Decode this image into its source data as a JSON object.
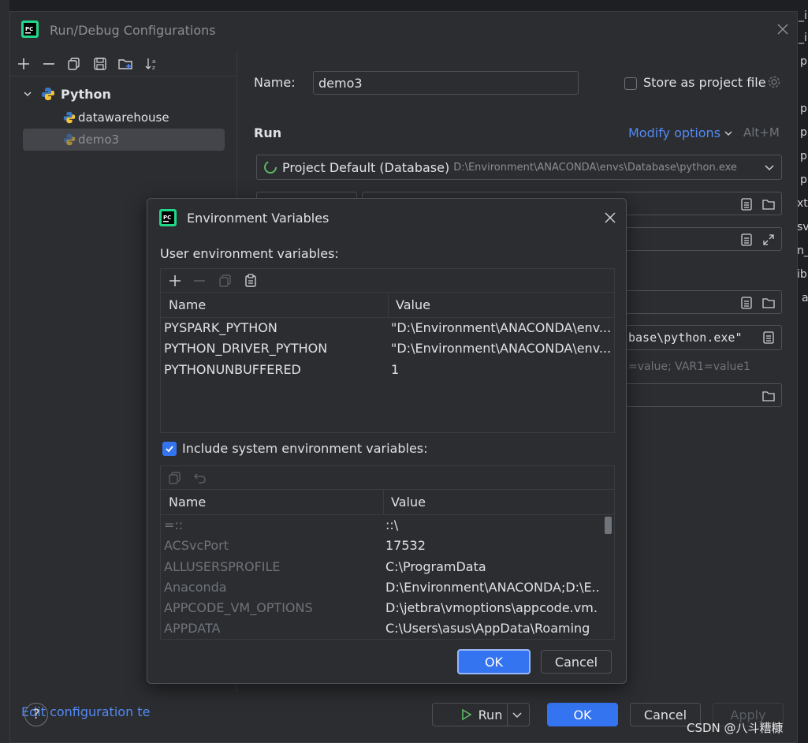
{
  "background": {
    "right_fragments": [
      "_i",
      "_i",
      "p",
      "p",
      "p",
      "p",
      "p",
      "xt",
      "sv",
      "n_",
      "ib",
      "a"
    ]
  },
  "main_dialog": {
    "title": "Run/Debug Configurations",
    "tree": {
      "group_label": "Python",
      "items": [
        "datawarehouse",
        "demo3"
      ]
    },
    "edit_config_link": "Edit configuration te",
    "name_label": "Name:",
    "name_value": "demo3",
    "store_as_project_file": "Store as project file",
    "run_section": "Run",
    "modify_options": "Modify options",
    "modify_shortcut": "Alt+M",
    "interpreter_name": "Project Default (Database)",
    "interpreter_path": "D:\\Environment\\ANACONDA\\envs\\Database\\python.exe",
    "interpreter_quote_fragment": "base\\python.exe\"",
    "env_hint_fragment": "=value; VAR1=value1",
    "buttons": {
      "run": "Run",
      "ok": "OK",
      "cancel": "Cancel",
      "apply": "Apply"
    }
  },
  "env_dialog": {
    "title": "Environment Variables",
    "user_vars_label": "User environment variables:",
    "columns": {
      "name": "Name",
      "value": "Value"
    },
    "user_vars": [
      {
        "name": "PYSPARK_PYTHON",
        "value": "\"D:\\Environment\\ANACONDA\\env..."
      },
      {
        "name": "PYTHON_DRIVER_PYTHON",
        "value": "\"D:\\Environment\\ANACONDA\\env..."
      },
      {
        "name": "PYTHONUNBUFFERED",
        "value": "1"
      }
    ],
    "include_system_label": "Include system environment variables:",
    "include_system_checked": true,
    "system_vars": [
      {
        "name": "=::",
        "value": "::\\"
      },
      {
        "name": "ACSvcPort",
        "value": "17532"
      },
      {
        "name": "ALLUSERSPROFILE",
        "value": "C:\\ProgramData"
      },
      {
        "name": "Anaconda",
        "value": "D:\\Environment\\ANACONDA;D:\\E..."
      },
      {
        "name": "APPCODE_VM_OPTIONS",
        "value": "D:\\jetbra\\vmoptions\\appcode.vm..."
      },
      {
        "name": "APPDATA",
        "value": "C:\\Users\\asus\\AppData\\Roaming"
      }
    ],
    "buttons": {
      "ok": "OK",
      "cancel": "Cancel"
    }
  },
  "watermark": "CSDN @八斗糟糠",
  "colors": {
    "accent": "#3574f0",
    "link": "#548af7",
    "background": "#2b2d30",
    "text": "#dfe1e5",
    "muted": "#6f737a"
  }
}
